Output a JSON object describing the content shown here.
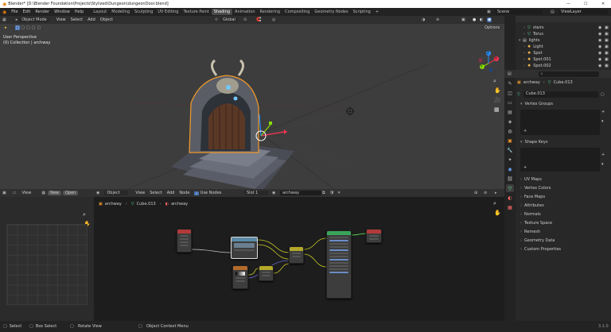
{
  "title_bar": {
    "title": "Blender* [D:\\Blender Foundation\\Projects\\Stylized\\Dungeon\\dungeonDoor.blend]",
    "minimize": "—",
    "maximize": "☐",
    "close": "✕"
  },
  "top_menu": {
    "items": [
      "File",
      "Edit",
      "Render",
      "Window",
      "Help"
    ],
    "workspaces": [
      "Layout",
      "Modeling",
      "Sculpting",
      "UV Editing",
      "Texture Paint",
      "Shading",
      "Animation",
      "Rendering",
      "Compositing",
      "Geometry Nodes",
      "Scripting"
    ],
    "active_workspace": "Shading",
    "add_tab": "+",
    "scene": "Scene",
    "view_layer": "ViewLayer"
  },
  "viewport_header": {
    "mode": "Object Mode",
    "menus": [
      "View",
      "Select",
      "Add",
      "Object"
    ],
    "orientation": "Global",
    "options": "Options"
  },
  "viewport": {
    "perspective": "User Perspective",
    "collection": "(0) Collection | archway",
    "gizmo_x": "X",
    "gizmo_y": "Y",
    "gizmo_z": "Z"
  },
  "outliner": {
    "items": [
      {
        "label": "stairs",
        "type": "mesh"
      },
      {
        "label": "Torus",
        "type": "mesh"
      },
      {
        "label": "lights",
        "type": "collection"
      },
      {
        "label": "Light",
        "type": "light"
      },
      {
        "label": "Spot",
        "type": "light"
      },
      {
        "label": "Spot.001",
        "type": "light"
      },
      {
        "label": "Spot.002",
        "type": "light"
      }
    ]
  },
  "properties": {
    "object": "archway",
    "mesh": "Cube.013",
    "mesh_field": "Cube.013",
    "sections": [
      {
        "label": "Vertex Groups",
        "open": true
      },
      {
        "label": "Shape Keys",
        "open": true
      },
      {
        "label": "UV Maps",
        "open": false
      },
      {
        "label": "Vertex Colors",
        "open": false
      },
      {
        "label": "Face Maps",
        "open": false
      },
      {
        "label": "Attributes",
        "open": false
      },
      {
        "label": "Normals",
        "open": false
      },
      {
        "label": "Texture Space",
        "open": false
      },
      {
        "label": "Remesh",
        "open": false
      },
      {
        "label": "Geometry Data",
        "open": false
      },
      {
        "label": "Custom Properties",
        "open": false
      }
    ]
  },
  "image_editor": {
    "view": "View",
    "new": "New",
    "open": "Open"
  },
  "node_editor": {
    "type": "Object",
    "menus": [
      "View",
      "Select",
      "Add",
      "Node"
    ],
    "use_nodes": "Use Nodes",
    "slot": "Slot 1",
    "material": "archway",
    "breadcrumb": [
      "archway",
      "Cube.013",
      "archway"
    ]
  },
  "status_bar": {
    "select": "Select",
    "box_select": "Box Select",
    "rotate_view": "Rotate View",
    "context_menu": "Object Context Menu",
    "version": "3.1.0"
  },
  "colors": {
    "accent": "#4772b3",
    "selection": "#f29b29",
    "header": "#303030"
  }
}
